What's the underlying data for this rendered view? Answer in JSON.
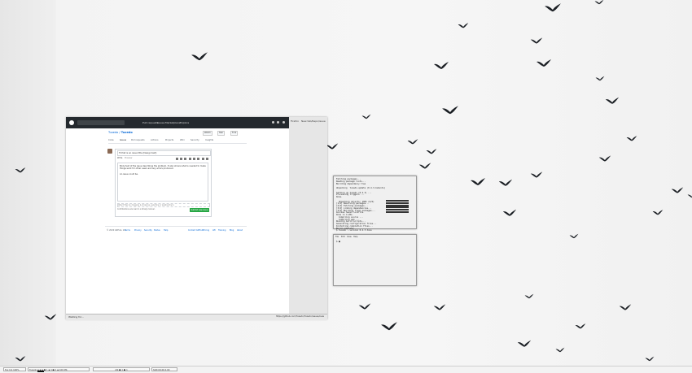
{
  "browser": {
    "header": {
      "nav": [
        "Pull requests",
        "Issues",
        "Marketplace",
        "Explore"
      ]
    },
    "right_header": [
      "Firefox",
      "New tab/Repo/issue"
    ],
    "repo": {
      "owner": "Tuxedo",
      "name": "Tuxedo"
    },
    "repo_buttons": [
      "Watch",
      "Star",
      "Fork"
    ],
    "tabs": [
      "Code",
      "Issues",
      "Pull requests",
      "Actions",
      "Projects",
      "Wiki",
      "Security",
      "Insights"
    ],
    "editor": {
      "title": "Tmhat is an issue title (Design text)",
      "tab_write": "Write",
      "tab_preview": "Preview",
      "body": "Body text of the issue describing the problem. It also shows what is needed to make things work for other users and any errors produced.\n\nAn issue could be.",
      "attach": "Attach files by dragging & dropping, selecting or pasting them.",
      "guidelines": "Contributions are read in a timely manner.",
      "submit": "Submit new issue"
    },
    "footer_links": [
      "© 2020 GitHub, Inc.",
      "Terms",
      "Privacy",
      "Security",
      "Status",
      "Help",
      "Contact GitHub",
      "Pricing",
      "API",
      "Training",
      "Blog",
      "About"
    ],
    "status_left": "Waiting for...",
    "status_right": "https://github.com/Tuxedo/Tuxedo/issues/new"
  },
  "term1": {
    "lines": [
      "Fetching packages...",
      "Reading package lists...",
      "Building dependency tree",
      "",
      "Unpacking  tuxedo-update (0.4.3-1ubuntu)",
      "",
      "Setting up tuxedo (0.4.3) ...",
      "Processing triggers ...",
      "Done.",
      "",
      "  Unpacking objects: 100% (6/6)",
      "[1/4] Resolving packages...",
      "[2/4] Fetching packages...",
      "[3/4] Linking dependencies...",
      "[4/4] Building fresh packages...",
      "success Saved lockfile.",
      "Done in 4.28s.",
      "  Compiling source ...",
      "  Compiling app ...",
      "Running build scripts...",
      "Generating configuration files...",
      "Installing completion files...",
      "Build complete.",
      "$ tuxedo --version 0.4.3 done"
    ],
    "progress": [
      1.0,
      1.0,
      1.0,
      1.0,
      1.0,
      1.0
    ]
  },
  "term2": {
    "menu": [
      "File",
      "Edit",
      "View",
      "Help"
    ],
    "prompt": "$ ■"
  },
  "taskbar": {
    "items": [
      "Tux 0.4  100%",
      "Tuxedo   ▪ ▪ ▪  ■ 1 ▪ 4  ■ 1 ▪ 100 Mb",
      "gtk ■ 1 ■ 1",
      "SUN 09:26  0.00"
    ]
  }
}
